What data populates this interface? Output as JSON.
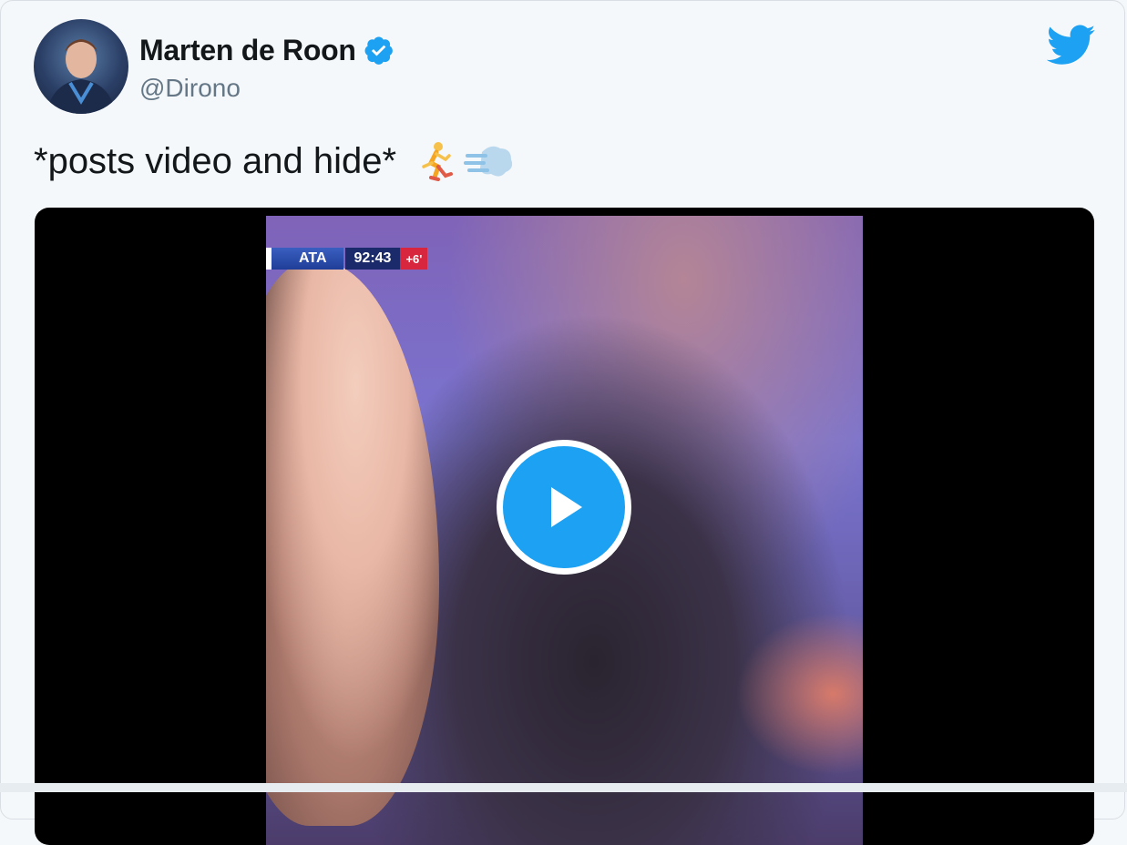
{
  "tweet": {
    "author": {
      "display_name": "Marten de Roon",
      "handle": "@Dirono",
      "verified": true
    },
    "text": "*posts video and hide*",
    "emojis": [
      "person-running",
      "dashing-away"
    ],
    "brand_icon": "twitter-bird-icon"
  },
  "media": {
    "type": "video",
    "scorebug": {
      "team": "ATA",
      "clock": "92:43",
      "added_time": "+6'"
    },
    "play_icon": "play-icon"
  },
  "colors": {
    "accent": "#1da1f2",
    "text_primary": "#14171a",
    "text_secondary": "#657786",
    "background": "#f5f8fa"
  }
}
